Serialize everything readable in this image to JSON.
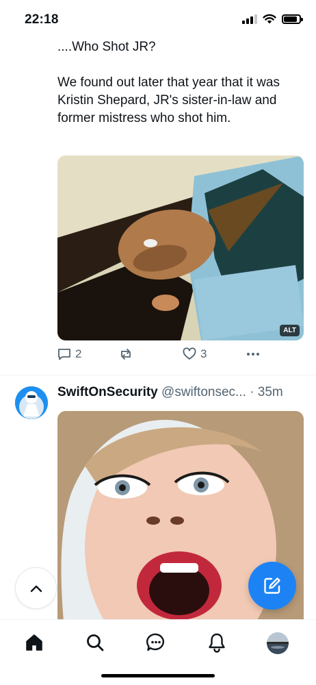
{
  "status_bar": {
    "time": "22:18",
    "icons": [
      "signal-icon",
      "wifi-icon",
      "battery-icon"
    ]
  },
  "post1": {
    "text": "....Who Shot JR?\n\nWe found out later that year that it was Kristin Shepard, JR's sister-in-law and former mistress who shot him.",
    "media_alt_badge": "ALT",
    "actions": {
      "reply_count": "2",
      "repost_count": "",
      "like_count": "3"
    }
  },
  "post2": {
    "display_name": "SwiftOnSecurity",
    "handle": "@swiftonsec...",
    "separator": "·",
    "time": "35m"
  },
  "colors": {
    "accent": "#1d83f5",
    "secondary_text": "#536471",
    "divider": "#eff3f4"
  },
  "nav": {
    "items": [
      "home-icon",
      "search-icon",
      "messages-icon",
      "notifications-icon",
      "profile-avatar"
    ]
  }
}
